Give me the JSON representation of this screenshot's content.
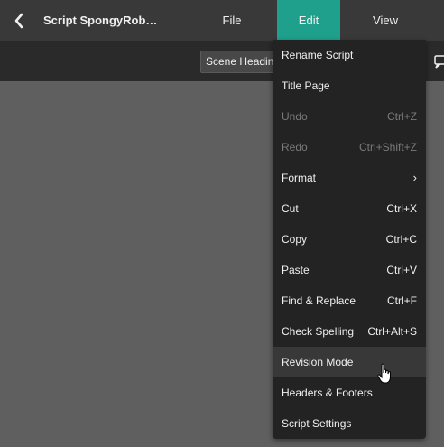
{
  "app": {
    "doc_title": "Script SpongyRob…",
    "back_icon": "chevron-left-icon"
  },
  "menubar": {
    "tabs": [
      {
        "label": "File",
        "active": false
      },
      {
        "label": "Edit",
        "active": true
      },
      {
        "label": "View",
        "active": false
      }
    ],
    "accent_color": "#1fa08c"
  },
  "toolbar": {
    "element_type": "Scene Heading",
    "icon": "comment-icon"
  },
  "edit_menu": {
    "items": [
      {
        "label": "Rename Script",
        "shortcut": "",
        "enabled": true
      },
      {
        "label": "Title Page",
        "shortcut": "",
        "enabled": true
      },
      {
        "label": "Undo",
        "shortcut": "Ctrl+Z",
        "enabled": false
      },
      {
        "label": "Redo",
        "shortcut": "Ctrl+Shift+Z",
        "enabled": false
      },
      {
        "label": "Format",
        "shortcut": "›",
        "enabled": true,
        "submenu": true
      },
      {
        "label": "Cut",
        "shortcut": "Ctrl+X",
        "enabled": true
      },
      {
        "label": "Copy",
        "shortcut": "Ctrl+C",
        "enabled": true
      },
      {
        "label": "Paste",
        "shortcut": "Ctrl+V",
        "enabled": true
      },
      {
        "label": "Find & Replace",
        "shortcut": "Ctrl+F",
        "enabled": true
      },
      {
        "label": "Check Spelling",
        "shortcut": "Ctrl+Alt+S",
        "enabled": true
      },
      {
        "label": "Revision Mode",
        "shortcut": "",
        "enabled": true,
        "hovered": true
      },
      {
        "label": "Headers & Footers",
        "shortcut": "",
        "enabled": true
      },
      {
        "label": "Script Settings",
        "shortcut": "",
        "enabled": true
      }
    ]
  },
  "pointer": "hand-pointer-icon"
}
